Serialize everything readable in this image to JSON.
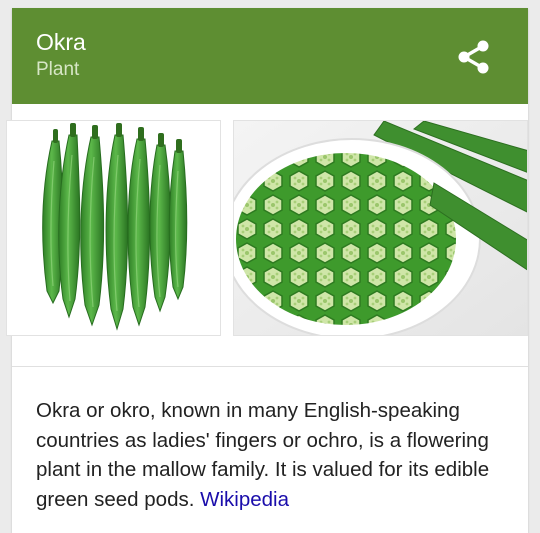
{
  "panel": {
    "title": "Okra",
    "subtitle": "Plant",
    "header_color": "#5e8e32",
    "share_icon": "share-icon"
  },
  "images": [
    {
      "name": "okra-pods-photo",
      "subject": "whole okra pods"
    },
    {
      "name": "sliced-okra-photo",
      "subject": "sliced okra on a plate"
    }
  ],
  "description": {
    "text": "Okra or okro, known in many English-speaking countries as ladies' fingers or ochro, is a flowering plant in the mallow family. It is valued for its edible green seed pods.",
    "source_link": "Wikipedia",
    "link_color": "#1a0dab"
  }
}
